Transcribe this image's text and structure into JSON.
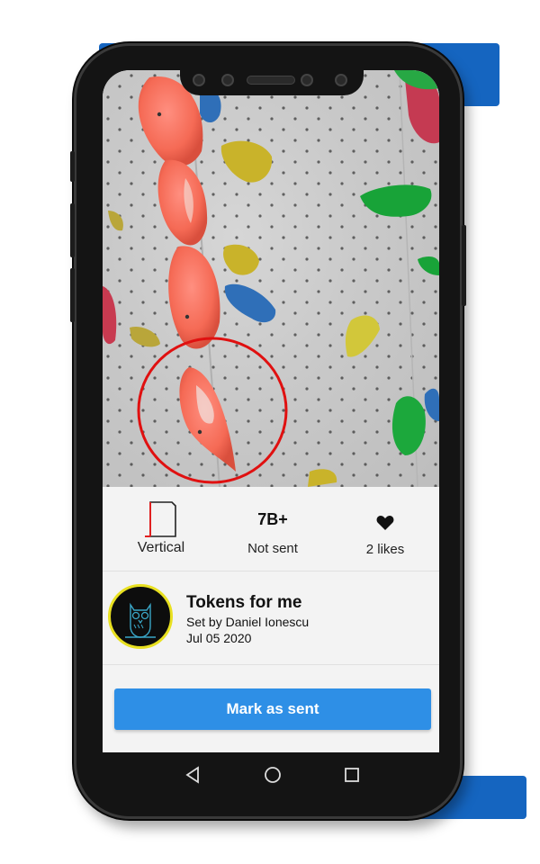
{
  "route": {
    "wall_type": "Vertical",
    "grade": "7B+",
    "send_status": "Not sent",
    "likes": "2 likes",
    "name": "Tokens for me",
    "setter_line": "Set by Daniel Ionescu",
    "date": "Jul 05 2020"
  },
  "actions": {
    "mark_sent_label": "Mark as sent"
  },
  "icons": {
    "wall": "vertical-wall-icon",
    "likes": "heart-icon",
    "avatar": "owl-icon",
    "nav_back": "triangle-back-icon",
    "nav_home": "circle-home-icon",
    "nav_recents": "square-recents-icon"
  },
  "colors": {
    "accent_button": "#2e8fe6",
    "avatar_ring": "#e8e020",
    "highlight_circle": "#e01010",
    "backdrop": "#1565c0"
  }
}
